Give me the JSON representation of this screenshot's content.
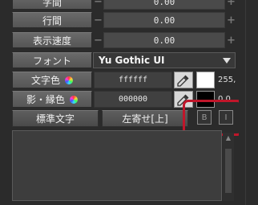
{
  "rows": {
    "char_spacing": {
      "label": "字間",
      "value": "0.00"
    },
    "line_spacing": {
      "label": "行間",
      "value": "0.00"
    },
    "display_speed": {
      "label": "表示速度",
      "value": "0.00"
    }
  },
  "font": {
    "label": "フォント",
    "value": "Yu Gothic UI"
  },
  "text_color": {
    "label": "文字色",
    "hex": "ffffff",
    "swatch": "#ffffff",
    "rgb_text": "255,"
  },
  "shadow_color": {
    "label": "影・縁色",
    "hex": "000000",
    "swatch": "#000000",
    "rgb_text": "0,0,"
  },
  "buttons": {
    "standard_text": "標準文字",
    "align": "左寄せ[上]",
    "bold": "B",
    "italic": "I"
  },
  "colors": {
    "highlight": "#c0162a"
  }
}
